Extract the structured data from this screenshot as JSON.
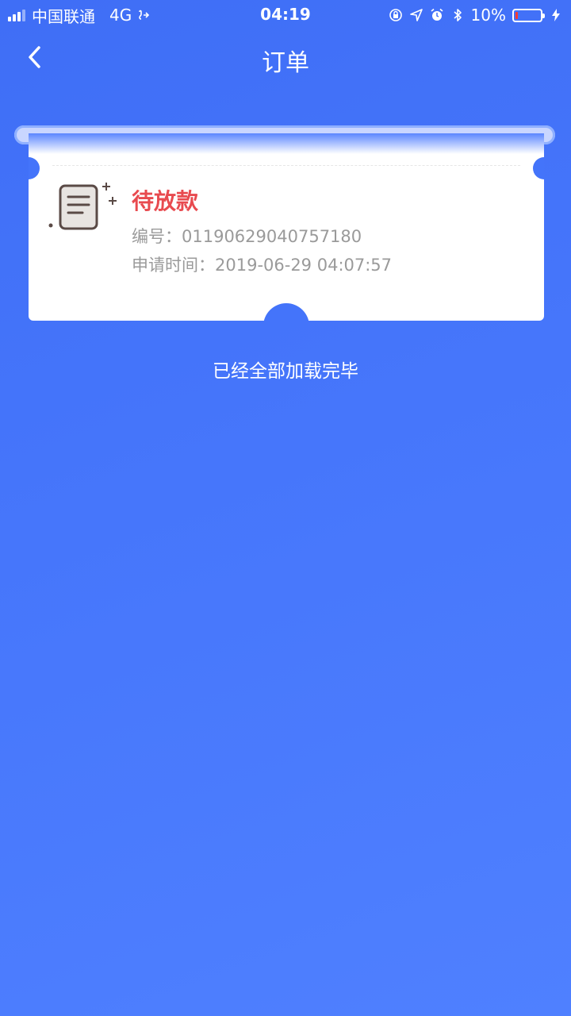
{
  "status_bar": {
    "carrier": "中国联通",
    "network": "4G",
    "time": "04:19",
    "battery_percent_text": "10%",
    "battery_level": 0.1
  },
  "nav": {
    "title": "订单"
  },
  "order": {
    "status": "待放款",
    "number_label": "编号：",
    "number_value": "01190629040757180",
    "time_label": "申请时间：",
    "time_value": "2019-06-29 04:07:57",
    "icon": "document-icon"
  },
  "footer": {
    "text": "已经全部加载完毕"
  },
  "colors": {
    "background": "#4474fa",
    "status_red": "#e84a4f",
    "info_gray": "#9a9a9a"
  }
}
